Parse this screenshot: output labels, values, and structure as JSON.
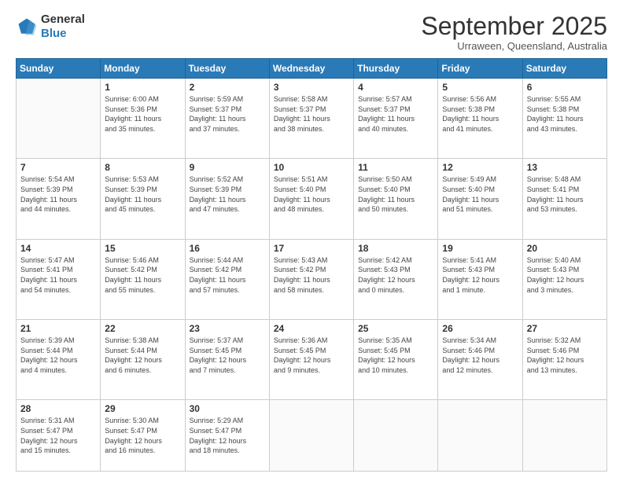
{
  "header": {
    "logo_general": "General",
    "logo_blue": "Blue",
    "month_title": "September 2025",
    "subtitle": "Urraween, Queensland, Australia"
  },
  "weekdays": [
    "Sunday",
    "Monday",
    "Tuesday",
    "Wednesday",
    "Thursday",
    "Friday",
    "Saturday"
  ],
  "rows": [
    [
      {
        "day": "",
        "text": ""
      },
      {
        "day": "1",
        "text": "Sunrise: 6:00 AM\nSunset: 5:36 PM\nDaylight: 11 hours\nand 35 minutes."
      },
      {
        "day": "2",
        "text": "Sunrise: 5:59 AM\nSunset: 5:37 PM\nDaylight: 11 hours\nand 37 minutes."
      },
      {
        "day": "3",
        "text": "Sunrise: 5:58 AM\nSunset: 5:37 PM\nDaylight: 11 hours\nand 38 minutes."
      },
      {
        "day": "4",
        "text": "Sunrise: 5:57 AM\nSunset: 5:37 PM\nDaylight: 11 hours\nand 40 minutes."
      },
      {
        "day": "5",
        "text": "Sunrise: 5:56 AM\nSunset: 5:38 PM\nDaylight: 11 hours\nand 41 minutes."
      },
      {
        "day": "6",
        "text": "Sunrise: 5:55 AM\nSunset: 5:38 PM\nDaylight: 11 hours\nand 43 minutes."
      }
    ],
    [
      {
        "day": "7",
        "text": "Sunrise: 5:54 AM\nSunset: 5:39 PM\nDaylight: 11 hours\nand 44 minutes."
      },
      {
        "day": "8",
        "text": "Sunrise: 5:53 AM\nSunset: 5:39 PM\nDaylight: 11 hours\nand 45 minutes."
      },
      {
        "day": "9",
        "text": "Sunrise: 5:52 AM\nSunset: 5:39 PM\nDaylight: 11 hours\nand 47 minutes."
      },
      {
        "day": "10",
        "text": "Sunrise: 5:51 AM\nSunset: 5:40 PM\nDaylight: 11 hours\nand 48 minutes."
      },
      {
        "day": "11",
        "text": "Sunrise: 5:50 AM\nSunset: 5:40 PM\nDaylight: 11 hours\nand 50 minutes."
      },
      {
        "day": "12",
        "text": "Sunrise: 5:49 AM\nSunset: 5:40 PM\nDaylight: 11 hours\nand 51 minutes."
      },
      {
        "day": "13",
        "text": "Sunrise: 5:48 AM\nSunset: 5:41 PM\nDaylight: 11 hours\nand 53 minutes."
      }
    ],
    [
      {
        "day": "14",
        "text": "Sunrise: 5:47 AM\nSunset: 5:41 PM\nDaylight: 11 hours\nand 54 minutes."
      },
      {
        "day": "15",
        "text": "Sunrise: 5:46 AM\nSunset: 5:42 PM\nDaylight: 11 hours\nand 55 minutes."
      },
      {
        "day": "16",
        "text": "Sunrise: 5:44 AM\nSunset: 5:42 PM\nDaylight: 11 hours\nand 57 minutes."
      },
      {
        "day": "17",
        "text": "Sunrise: 5:43 AM\nSunset: 5:42 PM\nDaylight: 11 hours\nand 58 minutes."
      },
      {
        "day": "18",
        "text": "Sunrise: 5:42 AM\nSunset: 5:43 PM\nDaylight: 12 hours\nand 0 minutes."
      },
      {
        "day": "19",
        "text": "Sunrise: 5:41 AM\nSunset: 5:43 PM\nDaylight: 12 hours\nand 1 minute."
      },
      {
        "day": "20",
        "text": "Sunrise: 5:40 AM\nSunset: 5:43 PM\nDaylight: 12 hours\nand 3 minutes."
      }
    ],
    [
      {
        "day": "21",
        "text": "Sunrise: 5:39 AM\nSunset: 5:44 PM\nDaylight: 12 hours\nand 4 minutes."
      },
      {
        "day": "22",
        "text": "Sunrise: 5:38 AM\nSunset: 5:44 PM\nDaylight: 12 hours\nand 6 minutes."
      },
      {
        "day": "23",
        "text": "Sunrise: 5:37 AM\nSunset: 5:45 PM\nDaylight: 12 hours\nand 7 minutes."
      },
      {
        "day": "24",
        "text": "Sunrise: 5:36 AM\nSunset: 5:45 PM\nDaylight: 12 hours\nand 9 minutes."
      },
      {
        "day": "25",
        "text": "Sunrise: 5:35 AM\nSunset: 5:45 PM\nDaylight: 12 hours\nand 10 minutes."
      },
      {
        "day": "26",
        "text": "Sunrise: 5:34 AM\nSunset: 5:46 PM\nDaylight: 12 hours\nand 12 minutes."
      },
      {
        "day": "27",
        "text": "Sunrise: 5:32 AM\nSunset: 5:46 PM\nDaylight: 12 hours\nand 13 minutes."
      }
    ],
    [
      {
        "day": "28",
        "text": "Sunrise: 5:31 AM\nSunset: 5:47 PM\nDaylight: 12 hours\nand 15 minutes."
      },
      {
        "day": "29",
        "text": "Sunrise: 5:30 AM\nSunset: 5:47 PM\nDaylight: 12 hours\nand 16 minutes."
      },
      {
        "day": "30",
        "text": "Sunrise: 5:29 AM\nSunset: 5:47 PM\nDaylight: 12 hours\nand 18 minutes."
      },
      {
        "day": "",
        "text": ""
      },
      {
        "day": "",
        "text": ""
      },
      {
        "day": "",
        "text": ""
      },
      {
        "day": "",
        "text": ""
      }
    ]
  ]
}
